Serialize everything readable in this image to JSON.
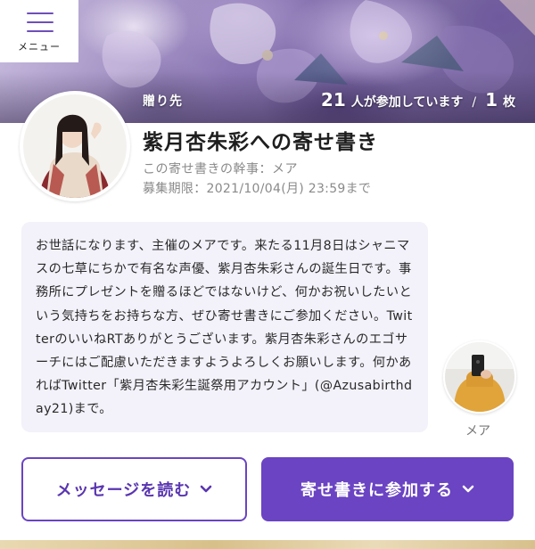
{
  "header": {
    "menu_label": "メニュー",
    "to_label": "贈り先",
    "participant_count": "21",
    "participant_suffix": "人が参加しています",
    "separator": "/",
    "sheet_count": "1",
    "sheet_suffix": "枚"
  },
  "recipient": {
    "title": "紫月杏朱彩への寄せ書き",
    "organizer_line": "この寄せ書きの幹事：メア",
    "deadline_line": "募集期限：2021/10/04(月) 23:59まで"
  },
  "message": {
    "text": "お世話になります、主催のメアです。来たる11月8日はシャニマスの七草にちかで有名な声優、紫月杏朱彩さんの誕生日です。事務所にプレゼントを贈るほどではないけど、何かお祝いしたいという気持ちをお持ちな方、ぜひ寄せ書きにご参加ください。TwitterのいいねRTありがとうございます。紫月杏朱彩さんのエゴサーチにはご配慮いただきますようよろしくお願いします。何かあればTwitter「紫月杏朱彩生誕祭用アカウント」(@Azusabirthday21)まで。",
    "organizer_name": "メア"
  },
  "actions": {
    "read_label": "メッセージを読む",
    "join_label": "寄せ書きに参加する"
  },
  "colors": {
    "accent": "#6a44c2",
    "message_bg": "#f3f1f9",
    "muted_text": "#8a8a8a"
  },
  "icons": {
    "menu": "hamburger-icon",
    "chevron": "chevron-down-icon"
  }
}
